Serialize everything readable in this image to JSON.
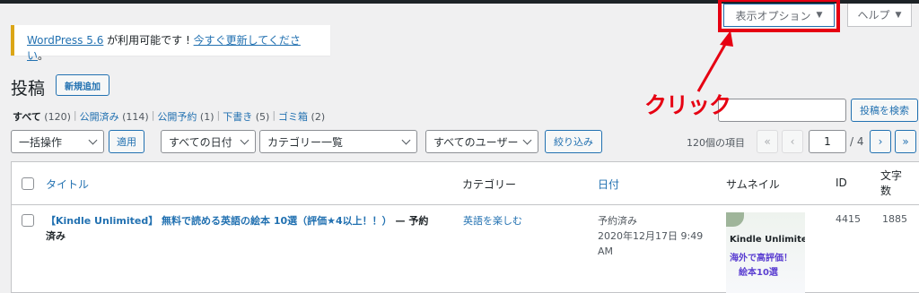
{
  "screen_meta": {
    "options_label": "表示オプション",
    "help_label": "ヘルプ",
    "toggle_glyph": "▼"
  },
  "notice": {
    "link1": "WordPress 5.6",
    "text_mid": " が利用可能です ! ",
    "link2": "今すぐ更新してください",
    "text_end": "。"
  },
  "page": {
    "title": "投稿",
    "add_new": "新規追加"
  },
  "views": [
    {
      "label": "すべて",
      "count": "(120)"
    },
    {
      "label": "公開済み",
      "count": "(114)"
    },
    {
      "label": "公開予約",
      "count": "(1)"
    },
    {
      "label": "下書き",
      "count": "(5)"
    },
    {
      "label": "ゴミ箱",
      "count": "(2)"
    }
  ],
  "separator": "|",
  "search": {
    "button": "投稿を検索"
  },
  "annotation": {
    "text": "クリック",
    "color": "#e60012"
  },
  "filters": {
    "bulk": "一括操作",
    "apply": "適用",
    "dates": "すべての日付",
    "categories": "カテゴリー一覧",
    "users": "すべてのユーザー",
    "filter": "絞り込み"
  },
  "pagination": {
    "items": "120個の項目",
    "first": "«",
    "prev": "‹",
    "current": "1",
    "total": "/ 4",
    "next": "›",
    "last": "»"
  },
  "table": {
    "headers": {
      "title": "タイトル",
      "category": "カテゴリー",
      "date": "日付",
      "thumbnail": "サムネイル",
      "id": "ID",
      "chars_line1": "文字",
      "chars_line2": "数"
    },
    "rows": [
      {
        "title": "【Kindle Unlimited】 無料で読める英語の絵本 10選（評価★4以上！！）",
        "state_line1": "— 予約",
        "state_line2": "済み",
        "category": "英語を楽しむ",
        "date_status": "予約済み",
        "date_line1": "2020年12月17日 9:49",
        "date_line2": "AM",
        "thumb_line1": "Kindle Unlimite",
        "thumb_line2": "海外で高評価！",
        "thumb_line3": "絵本10選",
        "id": "4415",
        "chars": "1885"
      }
    ]
  },
  "colors": {
    "accent": "#2271b1",
    "notice": "#dba617",
    "highlight": "#e60012"
  }
}
